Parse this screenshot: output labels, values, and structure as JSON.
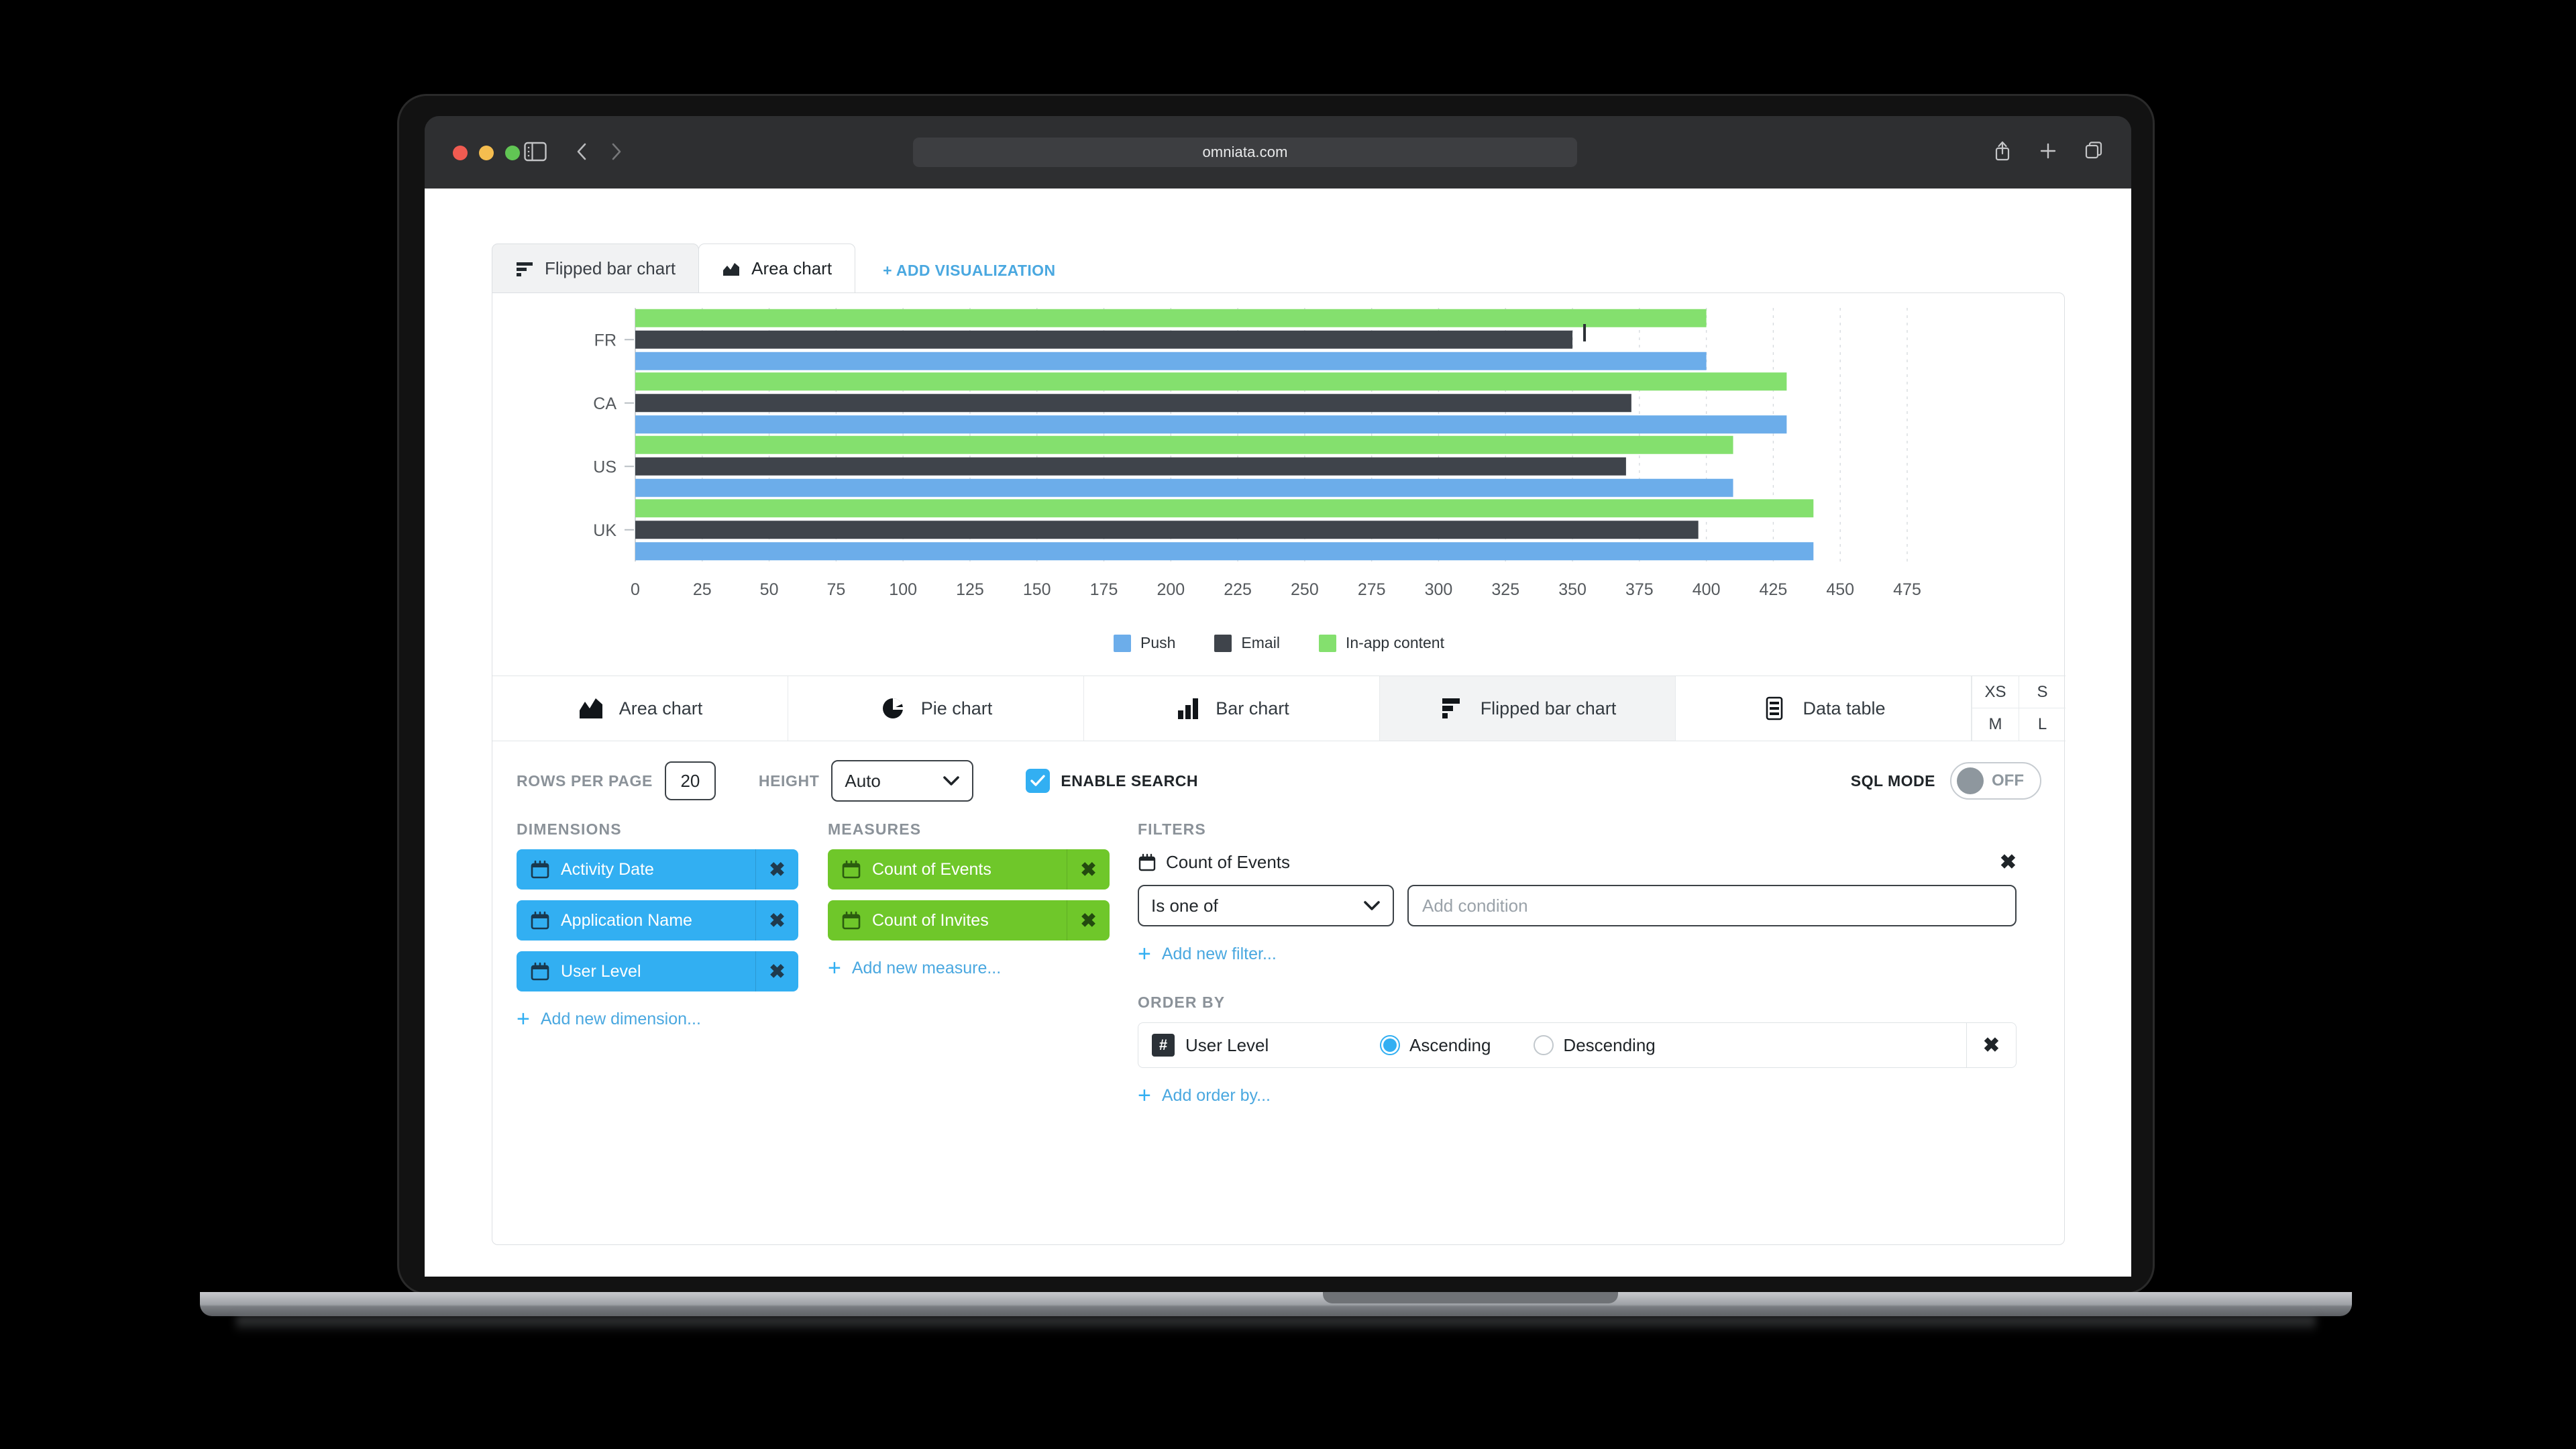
{
  "browser": {
    "url": "omniata.com",
    "icons": {
      "sidebar": "sidebar-toggle-icon",
      "back": "nav-back-icon",
      "forward": "nav-forward-icon",
      "share": "share-icon",
      "new_tab": "plus-icon",
      "tabs": "tab-overview-icon"
    }
  },
  "viz_tabs": [
    {
      "label": "Flipped bar chart",
      "icon": "flipped-bar-chart-icon",
      "active": false
    },
    {
      "label": "Area chart",
      "icon": "area-chart-icon",
      "active": true
    }
  ],
  "add_visualization_label": "+ ADD VISUALIZATION",
  "chart_data": {
    "type": "bar",
    "orientation": "horizontal",
    "title": "",
    "xlabel": "",
    "ylabel": "",
    "categories": [
      "FR",
      "CA",
      "US",
      "UK"
    ],
    "series": [
      {
        "name": "In-app content",
        "color": "#84e06e",
        "values": [
          400,
          430,
          410,
          440
        ]
      },
      {
        "name": "Email",
        "color": "#3f444b",
        "values": [
          350,
          372,
          370,
          397
        ]
      },
      {
        "name": "Push",
        "color": "#6cadea",
        "values": [
          400,
          430,
          410,
          440
        ]
      }
    ],
    "xlim": [
      0,
      475
    ],
    "xticks": [
      0,
      25,
      50,
      75,
      100,
      125,
      150,
      175,
      200,
      225,
      250,
      275,
      300,
      325,
      350,
      375,
      400,
      425,
      450,
      475
    ],
    "grid": true,
    "legend_position": "bottom",
    "legend": [
      "Push",
      "Email",
      "In-app content"
    ]
  },
  "chart_types": [
    {
      "label": "Area chart",
      "icon": "area-chart-icon",
      "active": false
    },
    {
      "label": "Pie chart",
      "icon": "pie-chart-icon",
      "active": false
    },
    {
      "label": "Bar chart",
      "icon": "bar-chart-icon",
      "active": false
    },
    {
      "label": "Flipped bar chart",
      "icon": "flipped-bar-chart-icon",
      "active": true
    },
    {
      "label": "Data table",
      "icon": "data-table-icon",
      "active": false
    }
  ],
  "sizes": [
    "XS",
    "S",
    "M",
    "L"
  ],
  "options": {
    "rows_per_page_label": "ROWS PER PAGE",
    "rows_per_page_value": "20",
    "height_label": "HEIGHT",
    "height_value": "Auto",
    "enable_search_label": "ENABLE SEARCH",
    "enable_search_checked": true,
    "sql_mode_label": "SQL MODE",
    "sql_mode_state": "OFF"
  },
  "dimensions": {
    "title": "DIMENSIONS",
    "items": [
      {
        "label": "Activity Date",
        "icon": "calendar-icon",
        "remove": "✖"
      },
      {
        "label": "Application Name",
        "icon": "calendar-icon",
        "remove": "✖"
      },
      {
        "label": "User Level",
        "icon": "calendar-icon",
        "remove": "✖"
      }
    ],
    "add_label": "Add new dimension..."
  },
  "measures": {
    "title": "MEASURES",
    "items": [
      {
        "label": "Count of Events",
        "icon": "calendar-icon",
        "remove": "✖"
      },
      {
        "label": "Count of Invites",
        "icon": "calendar-icon",
        "remove": "✖"
      }
    ],
    "add_label": "Add new measure..."
  },
  "filters": {
    "title": "FILTERS",
    "name": "Count of Events",
    "icon": "calendar-icon",
    "remove": "✖",
    "operator": "Is one of",
    "condition_placeholder": "Add condition",
    "condition_value": "",
    "add_label": "Add new filter..."
  },
  "order_by": {
    "title": "ORDER BY",
    "field": "User Level",
    "field_icon": "hash-icon",
    "ascending_label": "Ascending",
    "descending_label": "Descending",
    "selected": "Ascending",
    "remove": "✖",
    "add_label": "Add order by..."
  },
  "colors": {
    "accent_blue": "#32aff2",
    "accent_green": "#6fc72a",
    "link_blue": "#4aa8e0",
    "series_push": "#6cadea",
    "series_email": "#3f444b",
    "series_inapp": "#84e06e"
  }
}
